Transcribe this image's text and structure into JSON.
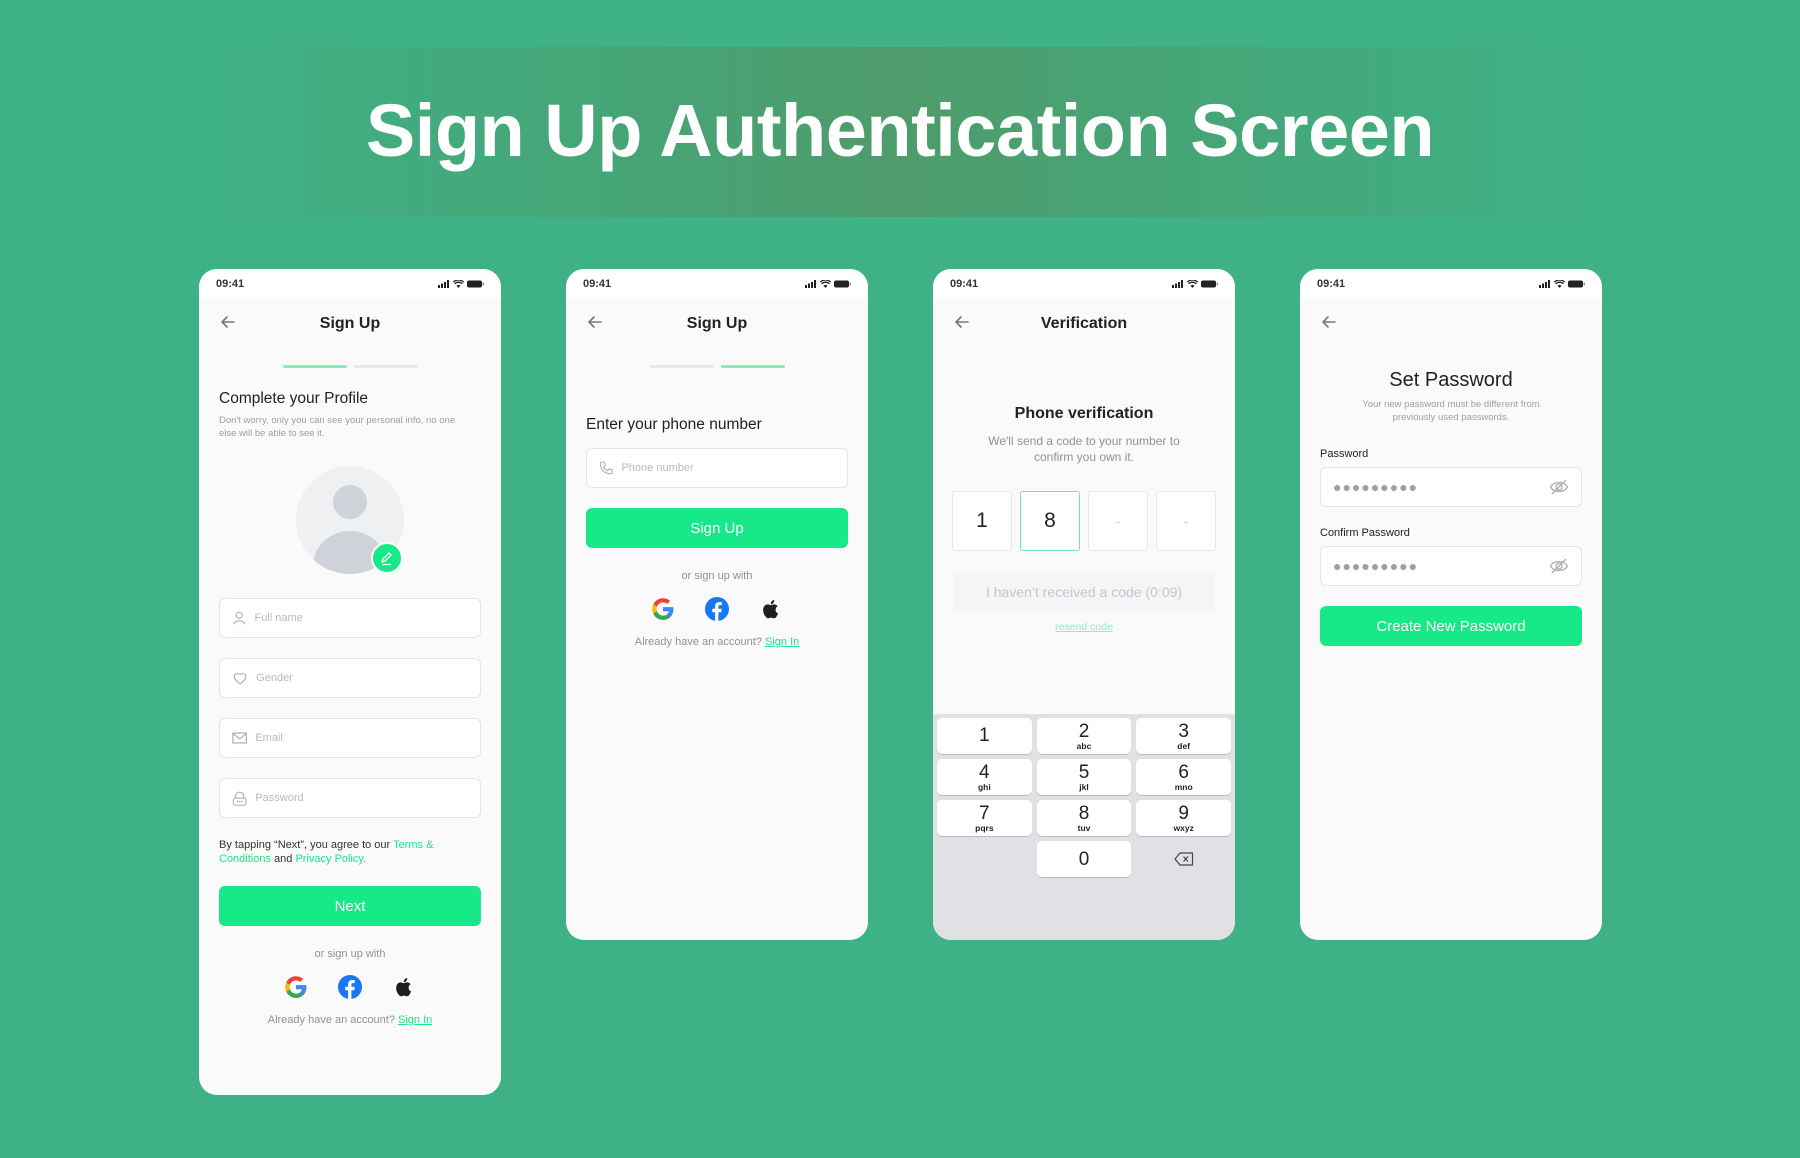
{
  "page": {
    "title": "Sign Up Authentication Screen"
  },
  "colors": {
    "background": "#3eb286",
    "accent": "#17e888",
    "accent_light": "#7ff0b8"
  },
  "status_bar": {
    "time": "09:41"
  },
  "screen1": {
    "nav_title": "Sign Up",
    "progress": {
      "current_step": 1,
      "total_steps": 2
    },
    "heading": "Complete your Profile",
    "subtext": "Don't worry, only you can see your personal info, no one else will be able to see it.",
    "fields": [
      {
        "placeholder": "Full name",
        "icon": "user-icon"
      },
      {
        "placeholder": "Gender",
        "icon": "heart-icon"
      },
      {
        "placeholder": "Email",
        "icon": "mail-icon"
      },
      {
        "placeholder": "Password",
        "icon": "lock-icon"
      }
    ],
    "terms_prefix": "By tapping “Next”, you agree to our ",
    "terms_link": "Terms & Conditions",
    "terms_and": " and ",
    "privacy_link": "Privacy Policy.",
    "next_label": "Next",
    "or_text": "or sign up with",
    "social": [
      "google-icon",
      "facebook-icon",
      "apple-icon"
    ],
    "already_text": "Already have an account? ",
    "signin_link": "Sign In"
  },
  "screen2": {
    "nav_title": "Sign Up",
    "progress": {
      "current_step": 2,
      "total_steps": 2
    },
    "heading": "Enter your phone number",
    "phone_placeholder": "Phone number",
    "signup_label": "Sign Up",
    "or_text": "or sign up with",
    "already_text": "Already have an account? ",
    "signin_link": "Sign In"
  },
  "screen3": {
    "nav_title": "Verification",
    "heading": "Phone verification",
    "subtext": "We'll send a code to your number to confirm you own it.",
    "otp": [
      "1",
      "8",
      "-",
      "-"
    ],
    "resend_info": "I haven’t received a code (0:09)",
    "resend_link": "resend code",
    "keys": [
      {
        "d": "1",
        "l": ""
      },
      {
        "d": "2",
        "l": "abc"
      },
      {
        "d": "3",
        "l": "def"
      },
      {
        "d": "4",
        "l": "ghi"
      },
      {
        "d": "5",
        "l": "jkl"
      },
      {
        "d": "6",
        "l": "mno"
      },
      {
        "d": "7",
        "l": "pqrs"
      },
      {
        "d": "8",
        "l": "tuv"
      },
      {
        "d": "9",
        "l": "wxyz"
      },
      {
        "d": "0",
        "l": ""
      }
    ]
  },
  "screen4": {
    "heading": "Set Password",
    "subtext": "Your new password must be different from previously used passwords.",
    "password_label": "Password",
    "password_value": "●●●●●●●●●",
    "confirm_label": "Confirm Password",
    "confirm_value": "●●●●●●●●●",
    "create_label": "Create New Password"
  }
}
